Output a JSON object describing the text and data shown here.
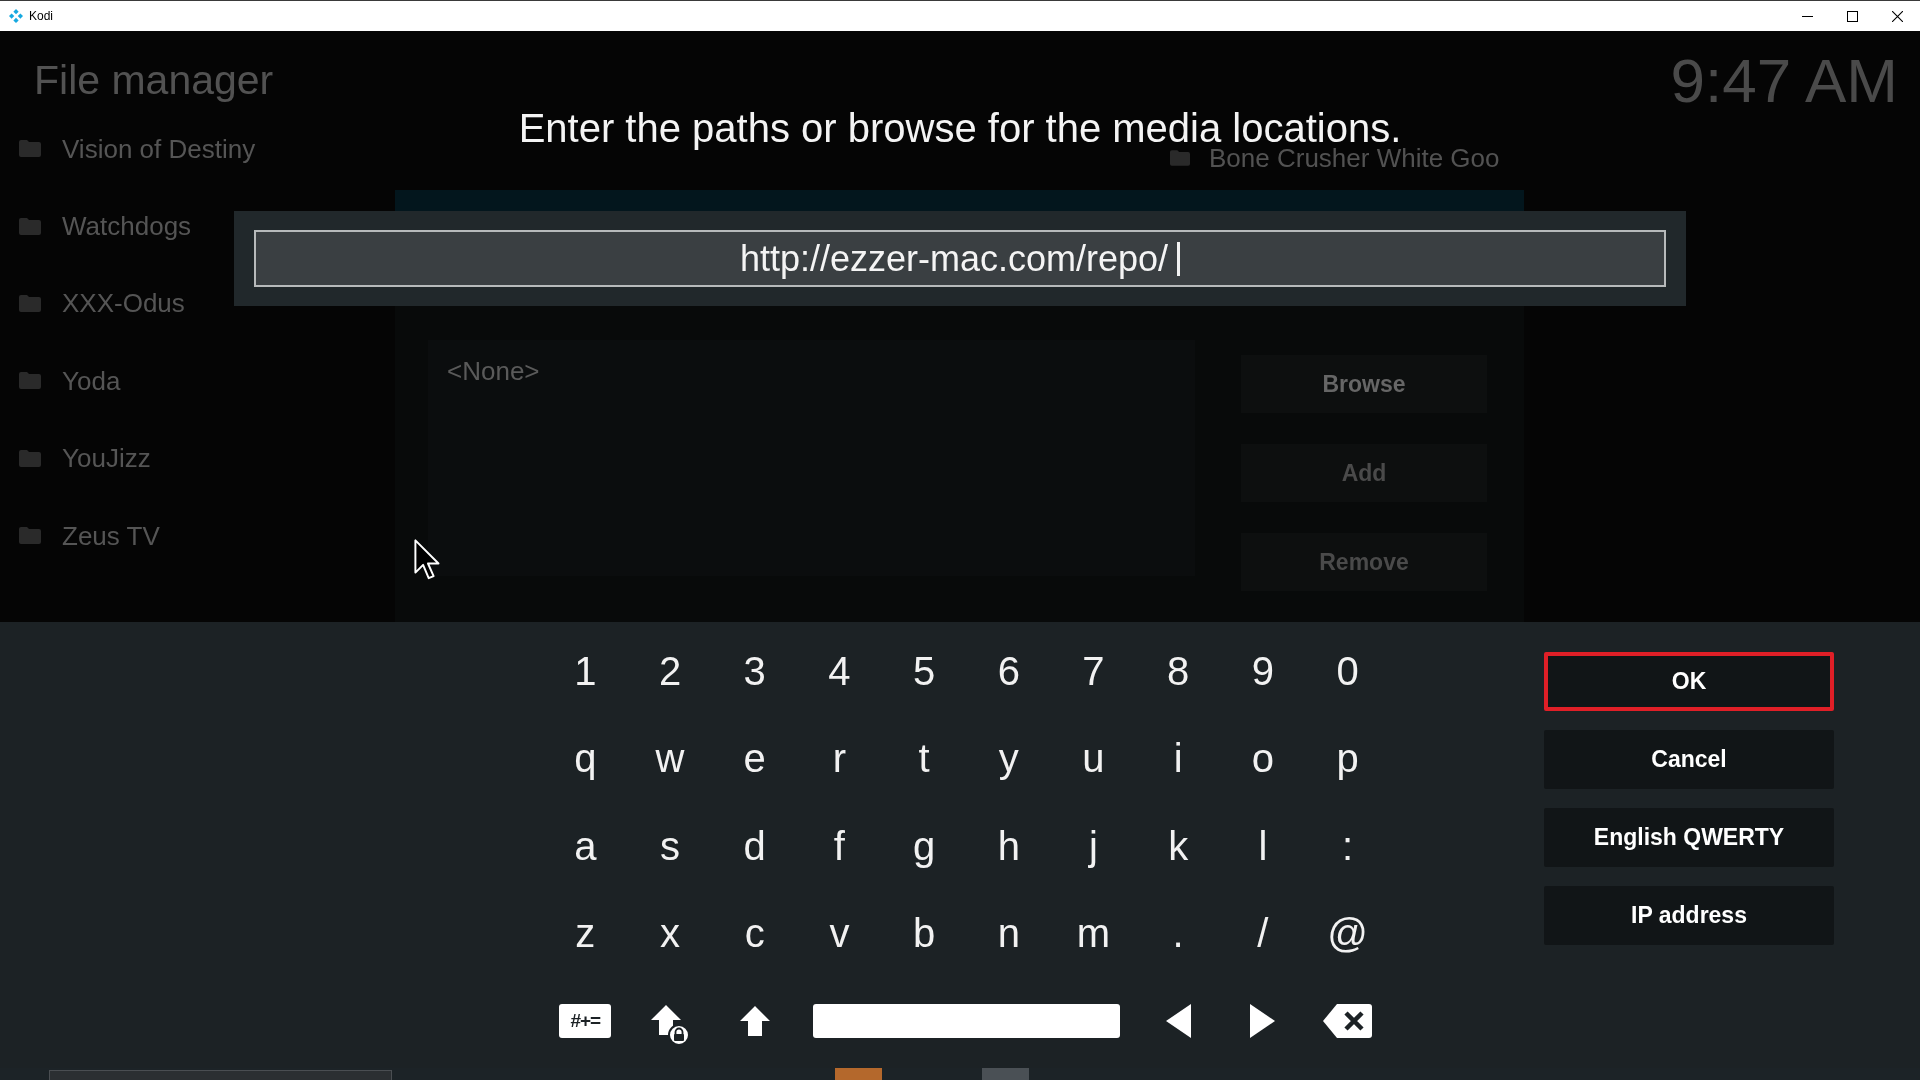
{
  "window": {
    "title": "Kodi"
  },
  "background": {
    "heading": "File manager",
    "clock": "9:47 AM",
    "sources": [
      {
        "label": "Vision of Destiny"
      },
      {
        "label": "Watchdogs"
      },
      {
        "label": "XXX-Odus"
      },
      {
        "label": "Yoda"
      },
      {
        "label": "YouJizz"
      },
      {
        "label": "Zeus TV"
      }
    ],
    "side_items": [
      {
        "label": "Bone Crusher White Goo"
      }
    ],
    "dialog": {
      "paths": [
        "<None>"
      ],
      "buttons": [
        {
          "label": "Browse",
          "disabled": false
        },
        {
          "label": "Add",
          "disabled": true
        },
        {
          "label": "Remove",
          "disabled": true
        }
      ]
    }
  },
  "keyboard": {
    "prompt": "Enter the paths or browse for the media locations.",
    "input": {
      "value": "http://ezzer-mac.com/repo/"
    },
    "rows": [
      [
        "1",
        "2",
        "3",
        "4",
        "5",
        "6",
        "7",
        "8",
        "9",
        "0"
      ],
      [
        "q",
        "w",
        "e",
        "r",
        "t",
        "y",
        "u",
        "i",
        "o",
        "p"
      ],
      [
        "a",
        "s",
        "d",
        "f",
        "g",
        "h",
        "j",
        "k",
        "l",
        ":"
      ],
      [
        "z",
        "x",
        "c",
        "v",
        "b",
        "n",
        "m",
        ".",
        "/",
        "@"
      ]
    ],
    "bottom_row": [
      {
        "kind": "symbols",
        "label": "#+="
      },
      {
        "kind": "caps_lock"
      },
      {
        "kind": "shift"
      },
      {
        "kind": "space"
      },
      {
        "kind": "left"
      },
      {
        "kind": "right"
      },
      {
        "kind": "backspace"
      }
    ],
    "actions": [
      {
        "label": "OK",
        "selected": true
      },
      {
        "label": "Cancel",
        "selected": false
      },
      {
        "label": "English QWERTY",
        "selected": false
      },
      {
        "label": "IP address",
        "selected": false
      }
    ]
  }
}
